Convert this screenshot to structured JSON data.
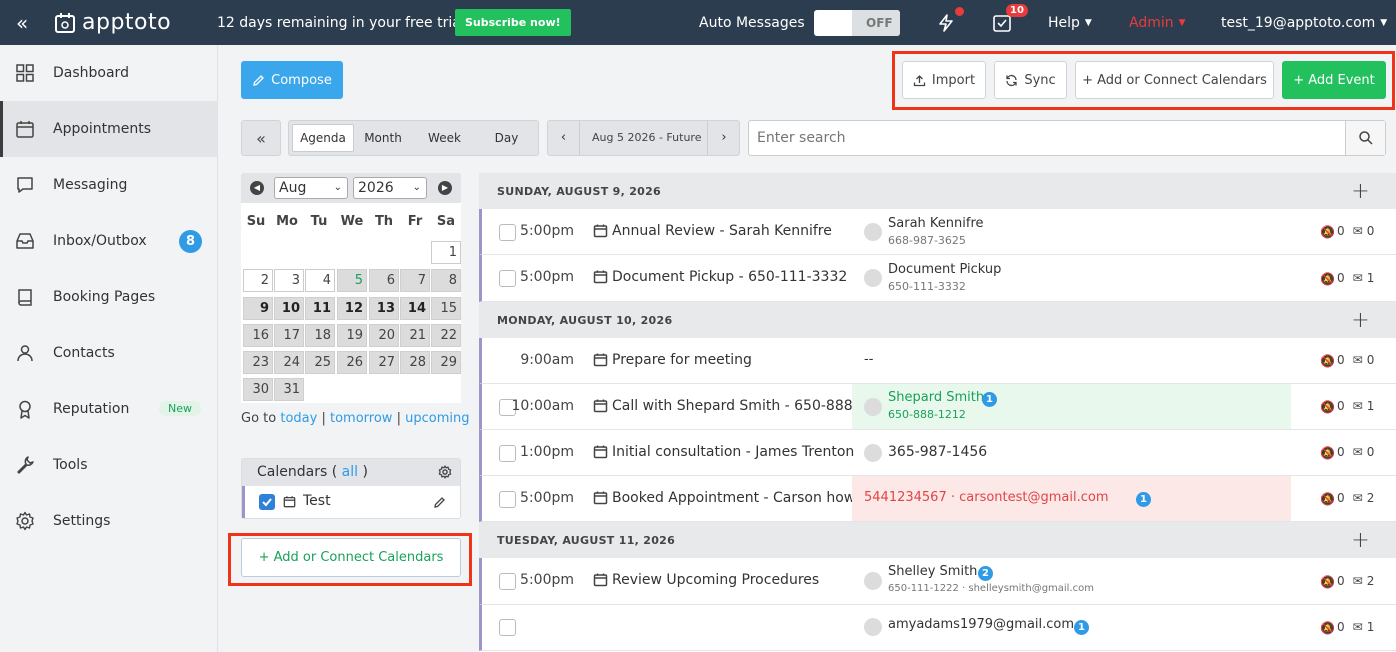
{
  "app": {
    "logo": "apptoto"
  },
  "topbar": {
    "trial_text": "12 days remaining in your free trial.",
    "subscribe_label": "Subscribe now!",
    "auto_messages_label": "Auto Messages",
    "auto_messages_state": "OFF",
    "tasks_badge": "10",
    "help_label": "Help",
    "admin_label": "Admin",
    "user_email": "test_19@apptoto.com"
  },
  "sidebar": {
    "items": [
      {
        "label": "Dashboard",
        "icon": "grid-icon"
      },
      {
        "label": "Appointments",
        "icon": "calendar-icon",
        "active": true
      },
      {
        "label": "Messaging",
        "icon": "chat-icon"
      },
      {
        "label": "Inbox/Outbox",
        "icon": "inbox-icon",
        "badge": "8"
      },
      {
        "label": "Booking Pages",
        "icon": "book-icon"
      },
      {
        "label": "Contacts",
        "icon": "person-icon"
      },
      {
        "label": "Reputation",
        "icon": "ribbon-icon",
        "badge": "New"
      },
      {
        "label": "Tools",
        "icon": "wrench-icon"
      },
      {
        "label": "Settings",
        "icon": "gear-icon"
      }
    ]
  },
  "toolbar": {
    "compose_label": "Compose",
    "import_label": "Import",
    "sync_label": "Sync",
    "add_connect_label": "+ Add or Connect Calendars",
    "add_event_label": "+ Add Event"
  },
  "views": {
    "tabs": [
      "Agenda",
      "Month",
      "Week",
      "Day"
    ],
    "active": "Agenda"
  },
  "daterange": {
    "label": "Aug 5 2026 - Future"
  },
  "search": {
    "placeholder": "Enter search"
  },
  "minical": {
    "month": "Aug",
    "year": "2026",
    "dow": [
      "Su",
      "Mo",
      "Tu",
      "We",
      "Th",
      "Fr",
      "Sa"
    ],
    "today": "5",
    "goto_label": "Go to",
    "today_link": "today",
    "tomorrow_link": "tomorrow",
    "upcoming_link": "upcoming"
  },
  "calendars": {
    "title": "Calendars (",
    "all_link": "all",
    "close_paren": ")",
    "items": [
      {
        "name": "Test",
        "checked": true
      }
    ],
    "add_connect_label": "+ Add or Connect Calendars"
  },
  "agenda": {
    "days": [
      {
        "header": "SUNDAY, AUGUST 9, 2026",
        "events": [
          {
            "time": "5:00pm",
            "title": "Annual Review - Sarah Kennifre",
            "contact": "Sarah Kennifre",
            "sub": "668-987-3625",
            "muted": "0",
            "msgs": "0",
            "check": true
          },
          {
            "time": "5:00pm",
            "title": "Document Pickup - 650-111-3332",
            "contact": "Document Pickup",
            "sub": "650-111-3332",
            "muted": "0",
            "msgs": "1",
            "check": true
          }
        ]
      },
      {
        "header": "MONDAY, AUGUST 10, 2026",
        "events": [
          {
            "time": "9:00am",
            "title": "Prepare for meeting",
            "contact": "--",
            "muted": "0",
            "msgs": "0",
            "check": false
          },
          {
            "time": "10:00am",
            "title": "Call with Shepard Smith - 650-888...",
            "contact": "Shepard Smith",
            "sub": "650-888-1212",
            "badge": "1",
            "muted": "0",
            "msgs": "1",
            "check": true,
            "status": "green"
          },
          {
            "time": "1:00pm",
            "title": "Initial consultation - James Trenton",
            "contact": "365-987-1456",
            "muted": "0",
            "msgs": "0",
            "check": true
          },
          {
            "time": "5:00pm",
            "title": "Booked Appointment - Carson how...",
            "contact": "5441234567 · carsontest@gmail.com",
            "badge": "1",
            "muted": "0",
            "msgs": "2",
            "check": true,
            "status": "red"
          }
        ]
      },
      {
        "header": "TUESDAY, AUGUST 11, 2026",
        "events": [
          {
            "time": "5:00pm",
            "title": "Review Upcoming Procedures",
            "contact": "Shelley Smith",
            "sub": "650-111-1222 · shelleysmith@gmail.com",
            "badge": "2",
            "muted": "0",
            "msgs": "2",
            "check": true
          },
          {
            "time": "",
            "title": "",
            "contact": "amyadams1979@gmail.com",
            "badge": "1",
            "muted": "0",
            "msgs": "1",
            "check": true
          }
        ]
      }
    ]
  },
  "colors": {
    "topbar": "#2c3d4f",
    "green": "#22c15e",
    "blue": "#2f9be6",
    "admin": "#e83b3b",
    "highlight": "#f0341a"
  }
}
